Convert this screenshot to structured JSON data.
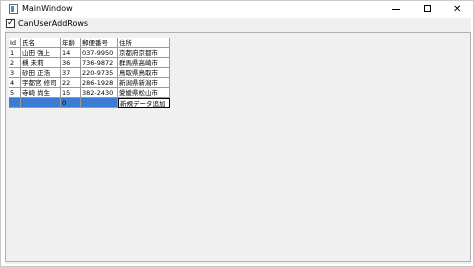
{
  "window": {
    "title": "MainWindow",
    "controls": {
      "minimize": "minimize",
      "maximize": "maximize",
      "close": "✕"
    }
  },
  "options": {
    "can_user_add_rows_label": "CanUserAddRows",
    "can_user_add_rows_checked": true
  },
  "grid": {
    "columns": [
      "Id",
      "氏名",
      "年齢",
      "郵便番号",
      "住所"
    ],
    "rows": [
      [
        "1",
        "山田 強上",
        "14",
        "037-9950",
        "京都府京都市"
      ],
      [
        "2",
        "槻 未莉",
        "36",
        "736-9872",
        "群馬県高崎市"
      ],
      [
        "3",
        "砂田 正浩",
        "37",
        "220-9735",
        "鳥取県鳥取市"
      ],
      [
        "4",
        "宇都宮 修司",
        "22",
        "286-1928",
        "新潟県新潟市"
      ],
      [
        "5",
        "寺崎 尚生",
        "15",
        "382-2430",
        "愛媛県松山市"
      ]
    ],
    "new_row": [
      "",
      "",
      "0",
      "",
      "新規データ追加"
    ]
  },
  "colors": {
    "selection": "#3a7bd5"
  }
}
